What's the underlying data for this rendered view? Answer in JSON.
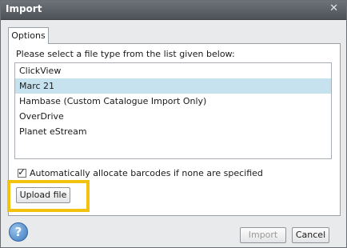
{
  "window": {
    "title": "Import",
    "close_glyph": "✕"
  },
  "tabs": [
    {
      "label": "Options"
    }
  ],
  "options": {
    "prompt": "Please select a file type from the list given below:",
    "file_types": [
      {
        "label": "ClickView",
        "selected": false
      },
      {
        "label": "Marc 21",
        "selected": true
      },
      {
        "label": "Hambase (Custom Catalogue Import Only)",
        "selected": false
      },
      {
        "label": "OverDrive",
        "selected": false
      },
      {
        "label": "Planet eStream",
        "selected": false
      }
    ],
    "auto_barcode": {
      "label": "Automatically allocate barcodes if none are specified",
      "checked": true,
      "tick": "✓"
    },
    "upload_button": "Upload file"
  },
  "footer": {
    "help_glyph": "?",
    "import_button": "Import",
    "import_enabled": false,
    "cancel_button": "Cancel"
  },
  "colors": {
    "selection": "#c6e2ee",
    "highlight_box": "#f2c20f",
    "titlebar": "#5a5f64"
  }
}
